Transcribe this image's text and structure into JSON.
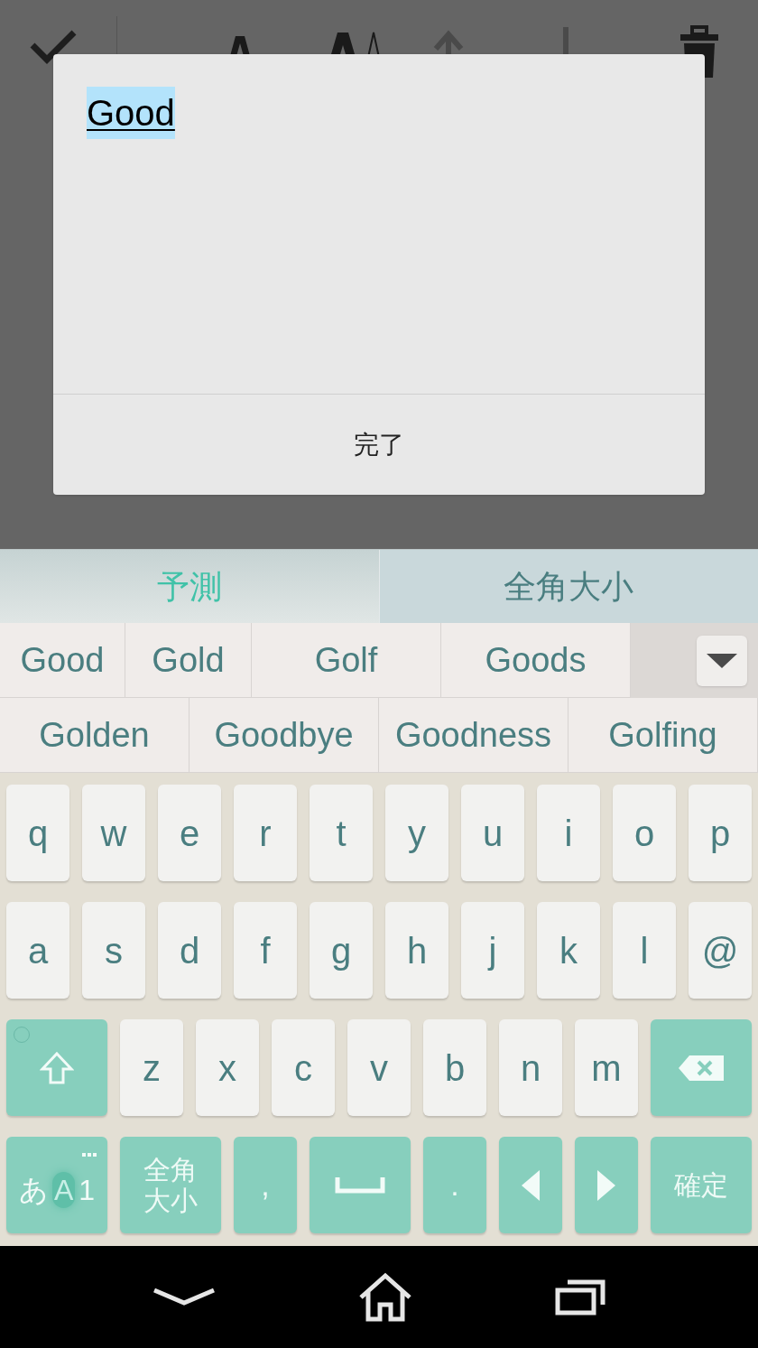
{
  "toolbar": {
    "items": [
      {
        "kind": "check"
      },
      {
        "kind": "separator"
      },
      {
        "kind": "text_size"
      },
      {
        "kind": "bold"
      },
      {
        "kind": "move_up"
      },
      {
        "kind": "move_down"
      },
      {
        "kind": "trash"
      }
    ]
  },
  "dialog": {
    "text": "Good",
    "composing": true,
    "button": "完了"
  },
  "keyboard": {
    "tabs": [
      {
        "label": "予測",
        "selected": true
      },
      {
        "label": "全角大小",
        "selected": false
      }
    ],
    "suggestion_rows": [
      [
        "Good",
        "Gold",
        "Golf",
        "Goods"
      ],
      [
        "Golden",
        "Goodbye",
        "Goodness",
        "Golfing"
      ]
    ],
    "expand_button": {
      "expanded": false
    },
    "key_rows": [
      {
        "keys": [
          {
            "kind": "letter",
            "label": "q"
          },
          {
            "kind": "letter",
            "label": "w"
          },
          {
            "kind": "letter",
            "label": "e"
          },
          {
            "kind": "letter",
            "label": "r"
          },
          {
            "kind": "letter",
            "label": "t"
          },
          {
            "kind": "letter",
            "label": "y"
          },
          {
            "kind": "letter",
            "label": "u"
          },
          {
            "kind": "letter",
            "label": "i"
          },
          {
            "kind": "letter",
            "label": "o"
          },
          {
            "kind": "letter",
            "label": "p"
          }
        ]
      },
      {
        "keys": [
          {
            "kind": "letter",
            "label": "a"
          },
          {
            "kind": "letter",
            "label": "s"
          },
          {
            "kind": "letter",
            "label": "d"
          },
          {
            "kind": "letter",
            "label": "f"
          },
          {
            "kind": "letter",
            "label": "g"
          },
          {
            "kind": "letter",
            "label": "h"
          },
          {
            "kind": "letter",
            "label": "j"
          },
          {
            "kind": "letter",
            "label": "k"
          },
          {
            "kind": "letter",
            "label": "l"
          },
          {
            "kind": "letter",
            "label": "@"
          }
        ]
      },
      {
        "keys": [
          {
            "kind": "shift"
          },
          {
            "kind": "letter",
            "label": "z"
          },
          {
            "kind": "letter",
            "label": "x"
          },
          {
            "kind": "letter",
            "label": "c"
          },
          {
            "kind": "letter",
            "label": "v"
          },
          {
            "kind": "letter",
            "label": "b"
          },
          {
            "kind": "letter",
            "label": "n"
          },
          {
            "kind": "letter",
            "label": "m"
          },
          {
            "kind": "backspace"
          }
        ]
      },
      {
        "keys": [
          {
            "kind": "mode",
            "segments": [
              {
                "text": "あ",
                "selected": false
              },
              {
                "text": "A",
                "selected": true
              },
              {
                "text": "1",
                "selected": false
              }
            ]
          },
          {
            "kind": "function",
            "lines": [
              "全角",
              "大小"
            ]
          },
          {
            "kind": "symbol",
            "label": ","
          },
          {
            "kind": "space"
          },
          {
            "kind": "symbol",
            "label": "."
          },
          {
            "kind": "left"
          },
          {
            "kind": "right"
          },
          {
            "kind": "function",
            "lines": [
              "確定"
            ]
          }
        ]
      }
    ]
  },
  "nav_bar": {
    "items": [
      {
        "kind": "back"
      },
      {
        "kind": "home"
      },
      {
        "kind": "recents"
      }
    ]
  }
}
